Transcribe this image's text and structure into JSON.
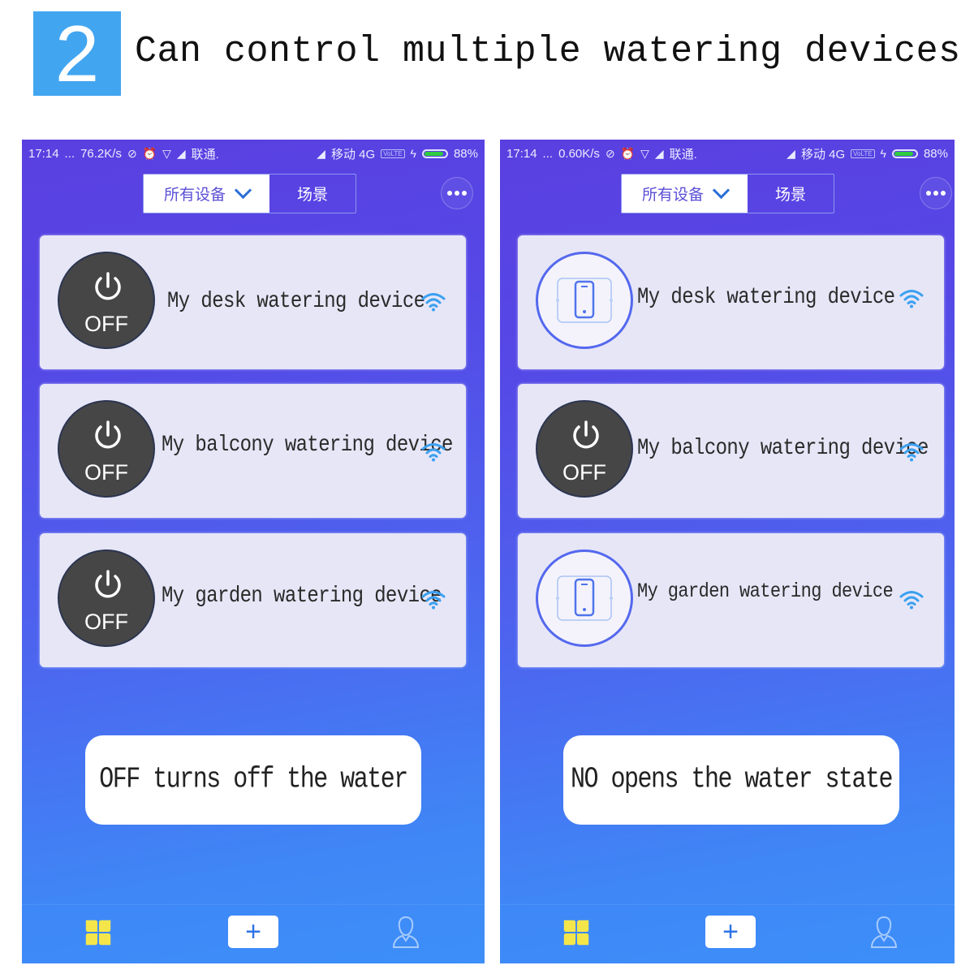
{
  "header": {
    "step_number": "2",
    "title": "Can control multiple watering devices"
  },
  "colors": {
    "badge": "#42a5f0",
    "off_button": "#474646",
    "on_ring": "#5468ee",
    "wifi": "#3aa0f0",
    "home_tab": "#f4e64a",
    "battery": "#2ecc3e"
  },
  "screens": [
    {
      "status_bar": {
        "time": "17:14",
        "dots": "...",
        "speed": "76.2K/s",
        "carrier1": "联通.",
        "carrier2": "移动 4G",
        "volte": "VoLTE",
        "battery": "88%",
        "battery_level": 0.88
      },
      "segmented": {
        "all_devices": "所有设备",
        "scenes": "场景"
      },
      "devices": [
        {
          "name": "My desk watering device",
          "state": "off",
          "state_label": "OFF",
          "wifi": "connected"
        },
        {
          "name": "My balcony watering device",
          "state": "off",
          "state_label": "OFF",
          "wifi": "connected"
        },
        {
          "name": "My garden watering device",
          "state": "off",
          "state_label": "OFF",
          "wifi": "connected"
        }
      ],
      "caption": "OFF turns off the water",
      "tabbar": {
        "home": "home-icon",
        "add": "+",
        "profile": "profile-icon"
      }
    },
    {
      "status_bar": {
        "time": "17:14",
        "dots": "...",
        "speed": "0.60K/s",
        "carrier1": "联通.",
        "carrier2": "移动 4G",
        "volte": "VoLTE",
        "battery": "88%",
        "battery_level": 0.88
      },
      "segmented": {
        "all_devices": "所有设备",
        "scenes": "场景"
      },
      "devices": [
        {
          "name": "My desk watering device",
          "state": "on",
          "state_label": "",
          "wifi": "connected"
        },
        {
          "name": "My balcony watering device",
          "state": "off",
          "state_label": "OFF",
          "wifi": "connected"
        },
        {
          "name": "My garden watering device",
          "state": "on",
          "state_label": "",
          "wifi": "connected"
        }
      ],
      "caption": "NO opens the water state",
      "tabbar": {
        "home": "home-icon",
        "add": "+",
        "profile": "profile-icon"
      }
    }
  ]
}
